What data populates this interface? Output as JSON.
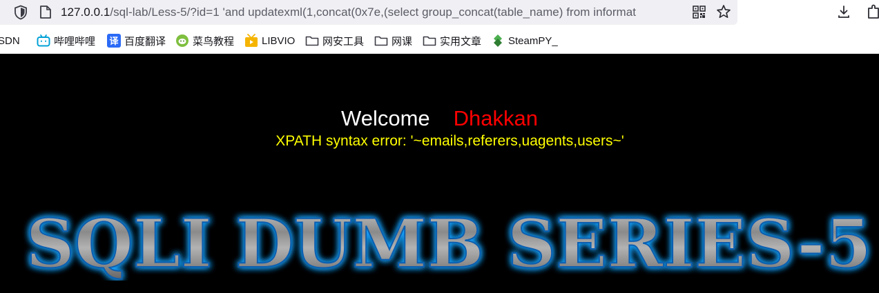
{
  "browser": {
    "url_host": "127.0.0.1",
    "url_rest": "/sql-lab/Less-5/?id=1 'and updatexml(1,concat(0x7e,(select group_concat(table_name) from informat"
  },
  "bookmarks": [
    {
      "label": "SDN",
      "icon": "csdn-icon"
    },
    {
      "label": "哔哩哔哩",
      "icon": "bilibili-icon"
    },
    {
      "label": "百度翻译",
      "icon": "baidu-translate-icon"
    },
    {
      "label": "菜鸟教程",
      "icon": "runoob-icon"
    },
    {
      "label": "LIBVIO",
      "icon": "libvio-icon"
    },
    {
      "label": "网安工具",
      "icon": "folder-icon"
    },
    {
      "label": "网课",
      "icon": "folder-icon"
    },
    {
      "label": "实用文章",
      "icon": "folder-icon"
    },
    {
      "label": "SteamPY_",
      "icon": "steampy-icon"
    }
  ],
  "page": {
    "welcome_label": "Welcome",
    "user_name": "Dhakkan",
    "error_message": "XPATH syntax error: '~emails,referers,uagents,users~'",
    "banner_text": "SQLI DUMB SERIES-5"
  },
  "colors": {
    "background": "#000000",
    "welcome": "#ffffff",
    "user_name": "#ff0000",
    "error": "#ffff00",
    "banner_glow": "#1aa3ff"
  }
}
